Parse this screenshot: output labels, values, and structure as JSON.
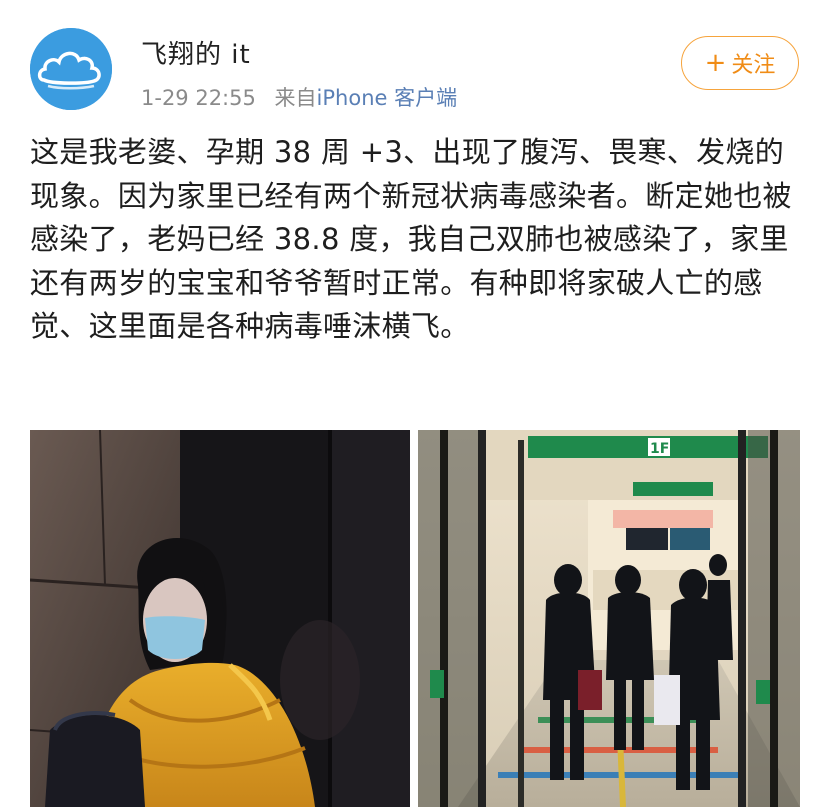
{
  "user": {
    "name": "飞翔的 it",
    "time": "1-29 22:55",
    "source_prefix": "来自",
    "source_app": "iPhone 客户端",
    "avatar_icon": "cloud-avatar-icon"
  },
  "follow_button": {
    "plus": "+",
    "label": "关注",
    "color": "#f08c16"
  },
  "post": {
    "text": "这是我老婆、孕期 38 周 +3、出现了腹泻、畏寒、发烧的现象。因为家里已经有两个新冠状病毒感染者。断定她也被感染了，老妈已经 38.8 度，我自己双肺也被感染了，家里还有两岁的宝宝和爷爷暂时正常。有种即将家破人亡的感觉、这里面是各种病毒唾沫横飞。"
  },
  "photos": {
    "photo_1_icon": "photo-woman-yellow-coat",
    "photo_2_icon": "photo-hospital-lobby",
    "hospital_sign_floor": "1F"
  }
}
